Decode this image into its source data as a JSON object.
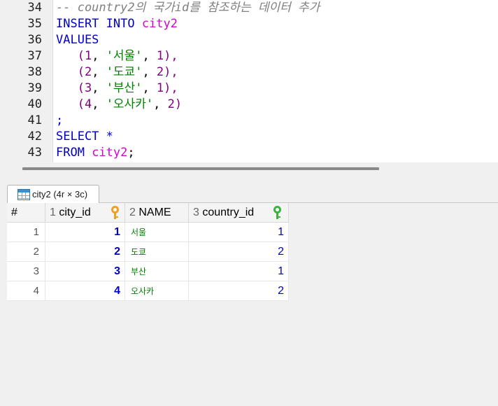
{
  "editor": {
    "lines": [
      {
        "num": "34",
        "tokens": [
          {
            "t": "-- country2의 국가id를 참조하는 데이터 추가",
            "c": "cmt"
          }
        ]
      },
      {
        "num": "35",
        "tokens": [
          {
            "t": "INSERT INTO ",
            "c": "kw"
          },
          {
            "t": "city2",
            "c": "tbl"
          }
        ]
      },
      {
        "num": "36",
        "tokens": [
          {
            "t": "VALUES",
            "c": "kw"
          }
        ]
      },
      {
        "num": "37",
        "tokens": [
          {
            "t": "   (",
            "c": "num"
          },
          {
            "t": "1",
            "c": "num"
          },
          {
            "t": ", ",
            "c": "pun"
          },
          {
            "t": "'서울'",
            "c": "str"
          },
          {
            "t": ", ",
            "c": "pun"
          },
          {
            "t": "1",
            "c": "num"
          },
          {
            "t": "),",
            "c": "num"
          }
        ]
      },
      {
        "num": "38",
        "tokens": [
          {
            "t": "   (",
            "c": "num"
          },
          {
            "t": "2",
            "c": "num"
          },
          {
            "t": ", ",
            "c": "pun"
          },
          {
            "t": "'도쿄'",
            "c": "str"
          },
          {
            "t": ", ",
            "c": "pun"
          },
          {
            "t": "2",
            "c": "num"
          },
          {
            "t": "),",
            "c": "num"
          }
        ]
      },
      {
        "num": "39",
        "tokens": [
          {
            "t": "   (",
            "c": "num"
          },
          {
            "t": "3",
            "c": "num"
          },
          {
            "t": ", ",
            "c": "pun"
          },
          {
            "t": "'부산'",
            "c": "str"
          },
          {
            "t": ", ",
            "c": "pun"
          },
          {
            "t": "1",
            "c": "num"
          },
          {
            "t": "),",
            "c": "num"
          }
        ]
      },
      {
        "num": "40",
        "tokens": [
          {
            "t": "   (",
            "c": "num"
          },
          {
            "t": "4",
            "c": "num"
          },
          {
            "t": ", ",
            "c": "pun"
          },
          {
            "t": "'오사카'",
            "c": "str"
          },
          {
            "t": ", ",
            "c": "pun"
          },
          {
            "t": "2",
            "c": "num"
          },
          {
            "t": ")",
            "c": "num"
          }
        ]
      },
      {
        "num": "41",
        "tokens": [
          {
            "t": ";",
            "c": "kw"
          }
        ]
      },
      {
        "num": "42",
        "tokens": [
          {
            "t": "SELECT ",
            "c": "kw"
          },
          {
            "t": "*",
            "c": "kw"
          }
        ]
      },
      {
        "num": "43",
        "tokens": [
          {
            "t": "FROM ",
            "c": "kw"
          },
          {
            "t": "city2",
            "c": "tbl"
          },
          {
            "t": ";",
            "c": "pun"
          }
        ]
      }
    ]
  },
  "results": {
    "tab_label": "city2 (4r × 3c)",
    "tab_icon": "table-icon",
    "headers": {
      "rownum": "#",
      "col1_num": "1",
      "col1_name": "city_id",
      "col1_key": "primary-key-icon",
      "col2_num": "2",
      "col2_name": "NAME",
      "col3_num": "3",
      "col3_name": "country_id",
      "col3_key": "foreign-key-icon"
    },
    "rows": [
      {
        "rownum": "1",
        "city_id": "1",
        "name": "서울",
        "country_id": "1"
      },
      {
        "rownum": "2",
        "city_id": "2",
        "name": "도쿄",
        "country_id": "2"
      },
      {
        "rownum": "3",
        "city_id": "3",
        "name": "부산",
        "country_id": "1"
      },
      {
        "rownum": "4",
        "city_id": "4",
        "name": "오사카",
        "country_id": "2"
      }
    ]
  },
  "colors": {
    "keyword": "#0000c8",
    "table_name": "#d400d4",
    "number": "#800080",
    "string": "#008000",
    "comment": "#808080",
    "primary_key": "#f0a020",
    "foreign_key": "#3cb43c"
  }
}
